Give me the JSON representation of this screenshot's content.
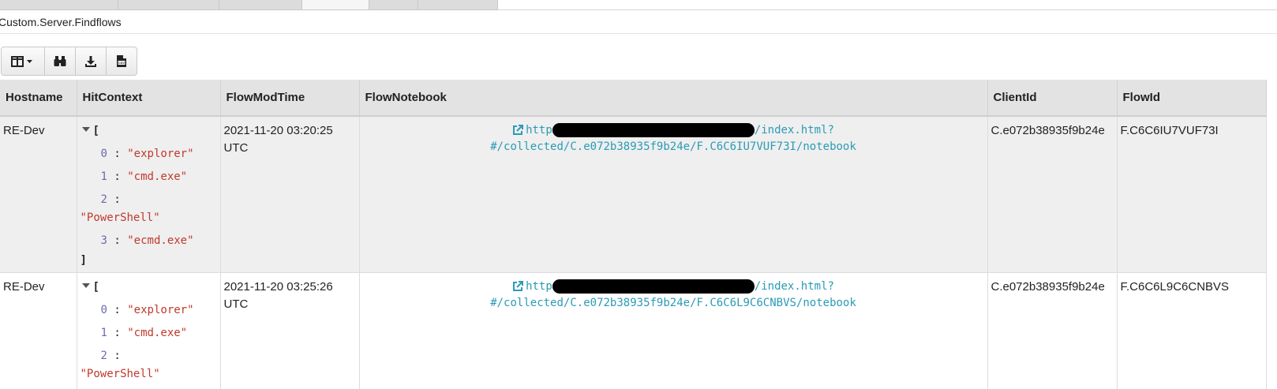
{
  "artifact": {
    "name": "Custom.Server.Findflows"
  },
  "toolbar": {
    "buttons": [
      {
        "name": "columns-toggle-button",
        "icon": "columns-icon"
      },
      {
        "name": "find-button",
        "icon": "binoculars-icon"
      },
      {
        "name": "download-button",
        "icon": "download-icon"
      },
      {
        "name": "csv-export-button",
        "icon": "csv-file-icon"
      }
    ]
  },
  "table": {
    "headers": [
      "Hostname",
      "HitContext",
      "FlowModTime",
      "FlowNotebook",
      "ClientId",
      "FlowId"
    ],
    "rows": [
      {
        "hostname": "RE-Dev",
        "hit_open": "[",
        "hit_close": "]",
        "hits": [
          {
            "idx": "0",
            "val": "\"explorer\""
          },
          {
            "idx": "1",
            "val": "\"cmd.exe\""
          },
          {
            "idx": "2",
            "val": "\"PowerShell\""
          },
          {
            "idx": "3",
            "val": "\"ecmd.exe\""
          }
        ],
        "modtime_date": "2021-11-20 03:20:25",
        "modtime_tz": "UTC",
        "notebook_prefix": "http",
        "notebook_suffix": "/index.html?",
        "notebook_path": "#/collected/C.e072b38935f9b24e/F.C6C6IU7VUF73I/notebook",
        "client_id": "C.e072b38935f9b24e",
        "flow_id": "F.C6C6IU7VUF73I"
      },
      {
        "hostname": "RE-Dev",
        "hit_open": "[",
        "hits": [
          {
            "idx": "0",
            "val": "\"explorer\""
          },
          {
            "idx": "1",
            "val": "\"cmd.exe\""
          },
          {
            "idx": "2",
            "val": "\"PowerShell\""
          }
        ],
        "modtime_date": "2021-11-20 03:25:26",
        "modtime_tz": "UTC",
        "notebook_prefix": "http",
        "notebook_suffix": "/index.html?",
        "notebook_path": "#/collected/C.e072b38935f9b24e/F.C6C6L9C6CNBVS/notebook",
        "client_id": "C.e072b38935f9b24e",
        "flow_id": "F.C6C6L9C6CNBVS"
      }
    ]
  },
  "colors": {
    "link": "#2a9bb5",
    "json_string": "#c0392b",
    "json_index": "#6a6ab0",
    "header_bg": "#e3e3e3"
  }
}
